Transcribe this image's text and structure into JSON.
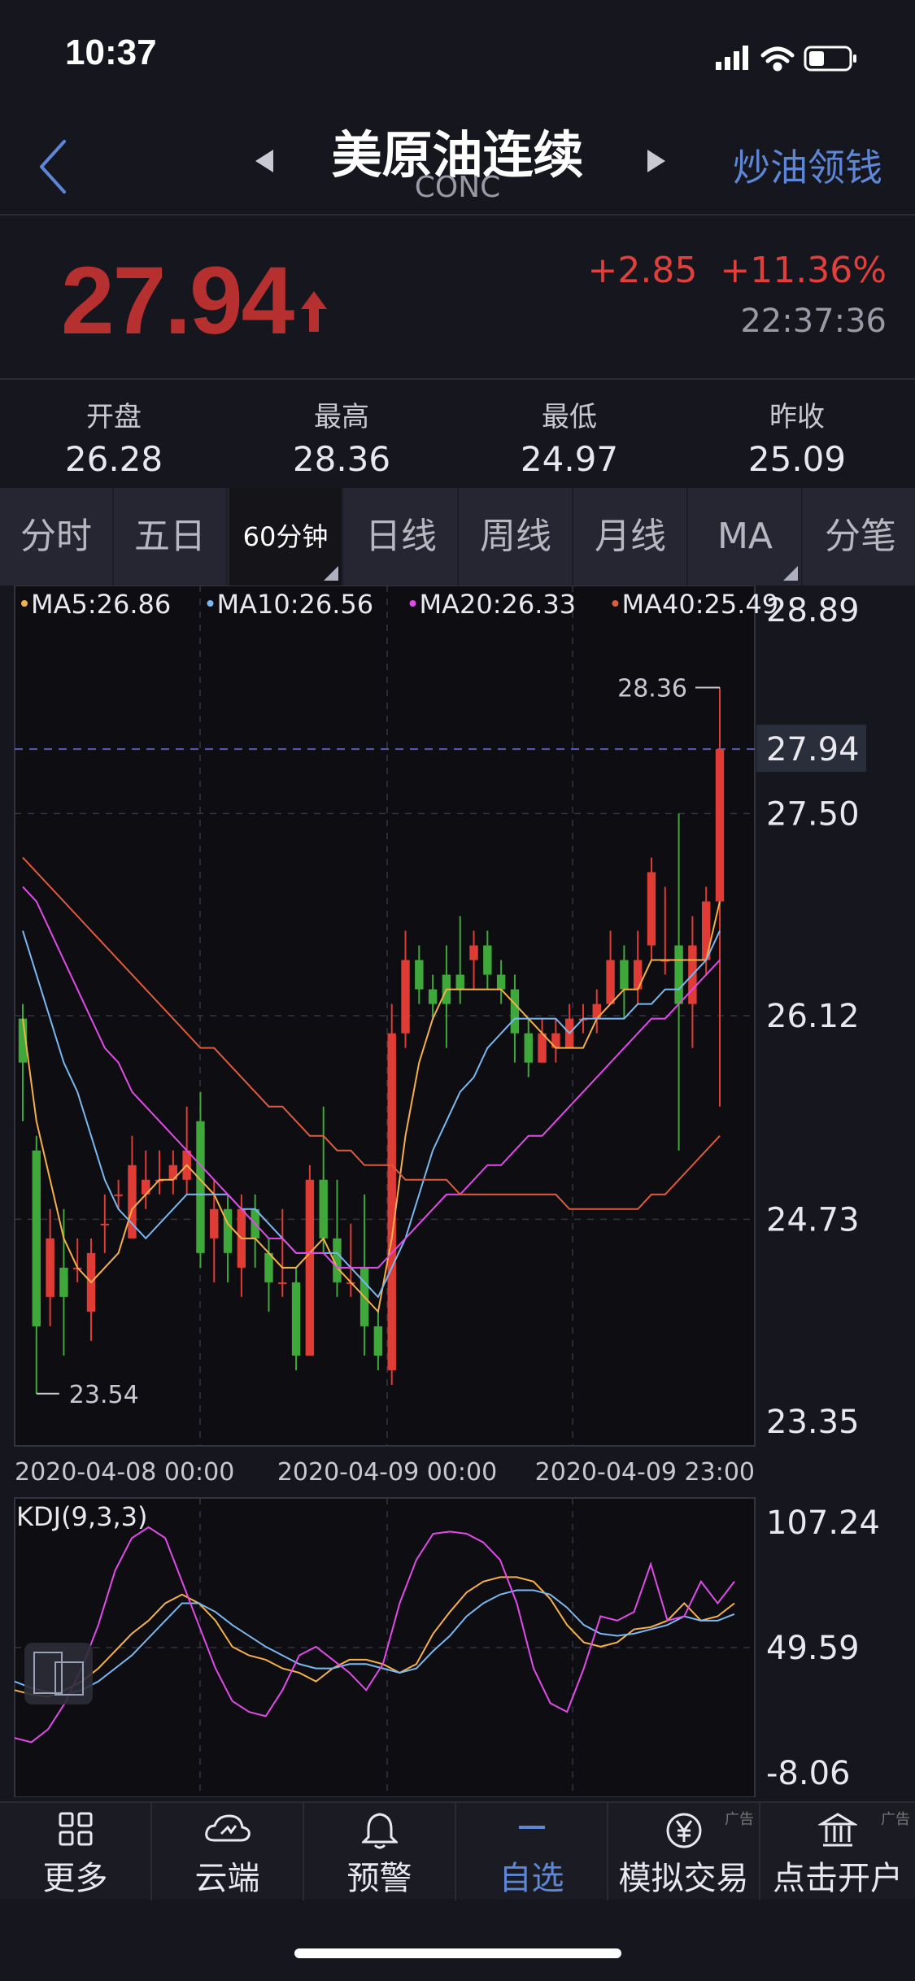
{
  "status_bar": {
    "time": "10:37"
  },
  "nav": {
    "title": "美原油连续",
    "subtitle": "CONC",
    "promo_label": "炒油领钱"
  },
  "quote": {
    "price": "27.94",
    "change": "+2.85",
    "change_pct": "+11.36%",
    "quote_time": "22:37:36"
  },
  "stats": [
    {
      "label": "开盘",
      "value": "26.28"
    },
    {
      "label": "最高",
      "value": "28.36"
    },
    {
      "label": "最低",
      "value": "24.97"
    },
    {
      "label": "昨收",
      "value": "25.09"
    }
  ],
  "period_tabs": [
    {
      "label": "分时"
    },
    {
      "label": "五日"
    },
    {
      "label": "60分钟",
      "active": true
    },
    {
      "label": "日线"
    },
    {
      "label": "周线"
    },
    {
      "label": "月线"
    },
    {
      "label": "MA"
    },
    {
      "label": "分笔"
    }
  ],
  "ma_legend": [
    {
      "label": "MA5:26.86",
      "color": "#f5b04a"
    },
    {
      "label": "MA10:26.56",
      "color": "#7ab8f0"
    },
    {
      "label": "MA20:26.33",
      "color": "#e04be8"
    },
    {
      "label": "MA40:25.49",
      "color": "#e05a3c"
    }
  ],
  "chart_data": [
    {
      "type": "candlestick",
      "title": "",
      "y_ticks": [
        "28.89",
        "27.50",
        "26.12",
        "24.73",
        "23.35"
      ],
      "ylim": [
        23.35,
        28.89
      ],
      "last_price_label": "27.94",
      "high_annotation": "28.36",
      "low_annotation": "23.54",
      "x_ticks": [
        "2020-04-08 00:00",
        "2020-04-09 00:00",
        "2020-04-09 23:00"
      ],
      "candles": [
        [
          26.1,
          25.8,
          26.2,
          25.4
        ],
        [
          25.2,
          24.0,
          25.3,
          23.54
        ],
        [
          24.2,
          24.6,
          24.8,
          24.0
        ],
        [
          24.4,
          24.2,
          24.8,
          23.8
        ],
        [
          24.4,
          24.4,
          24.6,
          24.3
        ],
        [
          24.1,
          24.5,
          24.6,
          23.9
        ],
        [
          24.7,
          24.7,
          24.9,
          24.5
        ],
        [
          24.9,
          24.9,
          25.0,
          24.8
        ],
        [
          24.6,
          25.1,
          25.3,
          24.6
        ],
        [
          24.9,
          25.0,
          25.2,
          24.8
        ],
        [
          25.0,
          25.0,
          25.2,
          24.9
        ],
        [
          25.0,
          25.1,
          25.2,
          24.9
        ],
        [
          25.0,
          25.2,
          25.5,
          24.9
        ],
        [
          25.4,
          24.5,
          25.6,
          24.4
        ],
        [
          24.6,
          24.8,
          25.0,
          24.3
        ],
        [
          24.8,
          24.5,
          24.9,
          24.3
        ],
        [
          24.4,
          24.8,
          24.9,
          24.2
        ],
        [
          24.8,
          24.6,
          24.9,
          24.4
        ],
        [
          24.5,
          24.3,
          24.6,
          24.1
        ],
        [
          24.3,
          24.3,
          24.8,
          24.2
        ],
        [
          24.3,
          23.8,
          24.4,
          23.7
        ],
        [
          23.8,
          25.0,
          25.1,
          23.8
        ],
        [
          25.0,
          24.6,
          25.5,
          24.5
        ],
        [
          24.6,
          24.3,
          25.0,
          24.2
        ],
        [
          24.3,
          24.3,
          24.7,
          24.2
        ],
        [
          24.4,
          24.0,
          24.9,
          23.8
        ],
        [
          24.0,
          23.8,
          24.1,
          23.7
        ],
        [
          23.7,
          26.0,
          26.2,
          23.6
        ],
        [
          26.0,
          26.5,
          26.7,
          25.9
        ],
        [
          26.5,
          26.3,
          26.6,
          26.2
        ],
        [
          26.3,
          26.2,
          26.4,
          26.1
        ],
        [
          26.4,
          26.2,
          26.6,
          25.9
        ],
        [
          26.4,
          26.3,
          26.8,
          26.2
        ],
        [
          26.5,
          26.6,
          26.7,
          26.3
        ],
        [
          26.6,
          26.4,
          26.7,
          26.3
        ],
        [
          26.4,
          26.3,
          26.5,
          26.2
        ],
        [
          26.3,
          26.0,
          26.4,
          25.8
        ],
        [
          26.0,
          25.8,
          26.1,
          25.7
        ],
        [
          25.8,
          26.0,
          26.1,
          25.8
        ],
        [
          25.9,
          26.0,
          26.1,
          25.8
        ],
        [
          25.9,
          26.1,
          26.2,
          25.9
        ],
        [
          26.1,
          26.1,
          26.2,
          26.0
        ],
        [
          26.1,
          26.2,
          26.3,
          26.0
        ],
        [
          26.2,
          26.5,
          26.7,
          26.2
        ],
        [
          26.5,
          26.3,
          26.6,
          26.1
        ],
        [
          26.3,
          26.5,
          26.7,
          26.2
        ],
        [
          26.6,
          27.1,
          27.2,
          26.5
        ],
        [
          26.5,
          26.5,
          27.0,
          26.4
        ],
        [
          26.6,
          26.2,
          27.5,
          25.2
        ],
        [
          26.2,
          26.6,
          26.8,
          25.9
        ],
        [
          26.5,
          26.9,
          27.0,
          26.4
        ],
        [
          26.9,
          27.94,
          28.36,
          25.5
        ]
      ],
      "ma5": [
        26.1,
        25.4,
        25.0,
        24.6,
        24.4,
        24.3,
        24.4,
        24.5,
        24.8,
        24.9,
        25.0,
        25.0,
        25.1,
        25.0,
        24.9,
        24.7,
        24.6,
        24.6,
        24.5,
        24.4,
        24.4,
        24.5,
        24.6,
        24.4,
        24.3,
        24.2,
        24.1,
        24.6,
        25.3,
        25.8,
        26.1,
        26.3,
        26.3,
        26.3,
        26.3,
        26.3,
        26.2,
        26.1,
        26.0,
        25.9,
        25.9,
        25.9,
        26.1,
        26.2,
        26.3,
        26.3,
        26.5,
        26.5,
        26.5,
        26.5,
        26.5,
        26.9
      ],
      "ma10": [
        26.7,
        26.4,
        26.1,
        25.8,
        25.6,
        25.3,
        25.0,
        24.8,
        24.7,
        24.6,
        24.7,
        24.8,
        24.9,
        24.9,
        24.9,
        24.9,
        24.8,
        24.8,
        24.7,
        24.6,
        24.5,
        24.5,
        24.5,
        24.5,
        24.4,
        24.3,
        24.2,
        24.4,
        24.6,
        24.9,
        25.2,
        25.4,
        25.6,
        25.7,
        25.9,
        26.0,
        26.1,
        26.1,
        26.1,
        26.1,
        26.0,
        26.1,
        26.1,
        26.1,
        26.1,
        26.2,
        26.2,
        26.3,
        26.3,
        26.4,
        26.5,
        26.7
      ],
      "ma20": [
        27.0,
        26.9,
        26.7,
        26.5,
        26.3,
        26.1,
        25.9,
        25.8,
        25.6,
        25.5,
        25.4,
        25.3,
        25.2,
        25.1,
        25.0,
        24.9,
        24.8,
        24.7,
        24.6,
        24.6,
        24.5,
        24.5,
        24.5,
        24.4,
        24.4,
        24.4,
        24.4,
        24.5,
        24.6,
        24.7,
        24.8,
        24.9,
        24.9,
        25.0,
        25.1,
        25.1,
        25.2,
        25.3,
        25.3,
        25.4,
        25.5,
        25.6,
        25.7,
        25.8,
        25.9,
        26.0,
        26.1,
        26.1,
        26.2,
        26.3,
        26.4,
        26.5
      ],
      "ma40": [
        27.2,
        27.1,
        27.0,
        26.9,
        26.8,
        26.7,
        26.6,
        26.5,
        26.4,
        26.3,
        26.2,
        26.1,
        26.0,
        25.9,
        25.9,
        25.8,
        25.7,
        25.6,
        25.5,
        25.5,
        25.4,
        25.3,
        25.3,
        25.2,
        25.2,
        25.1,
        25.1,
        25.1,
        25.0,
        25.0,
        25.0,
        25.0,
        24.9,
        24.9,
        24.9,
        24.9,
        24.9,
        24.9,
        24.9,
        24.9,
        24.8,
        24.8,
        24.8,
        24.8,
        24.8,
        24.8,
        24.9,
        24.9,
        25.0,
        25.1,
        25.2,
        25.3
      ]
    },
    {
      "type": "line",
      "title": "KDJ(9,3,3)",
      "y_ticks": [
        "107.24",
        "49.59",
        "-8.06"
      ],
      "ylim": [
        -8.06,
        107.24
      ],
      "series": [
        {
          "name": "K",
          "color": "#f5b04a",
          "values": [
            30,
            28,
            27,
            30,
            34,
            40,
            48,
            56,
            62,
            70,
            74,
            70,
            62,
            50,
            46,
            44,
            40,
            38,
            34,
            40,
            44,
            44,
            42,
            38,
            42,
            56,
            66,
            75,
            80,
            82,
            82,
            80,
            72,
            60,
            52,
            50,
            52,
            58,
            59,
            62,
            70,
            62,
            64,
            70
          ]
        },
        {
          "name": "D",
          "color": "#7ab8f0",
          "values": [
            34,
            31,
            29,
            28,
            30,
            34,
            40,
            46,
            54,
            62,
            70,
            70,
            66,
            60,
            55,
            50,
            46,
            42,
            40,
            40,
            42,
            42,
            40,
            38,
            40,
            48,
            55,
            64,
            70,
            74,
            76,
            76,
            74,
            68,
            60,
            56,
            55,
            56,
            58,
            60,
            64,
            62,
            62,
            65
          ]
        },
        {
          "name": "J",
          "color": "#e04be8",
          "values": [
            8,
            6,
            12,
            24,
            40,
            60,
            85,
            100,
            105,
            100,
            80,
            60,
            40,
            25,
            20,
            18,
            30,
            46,
            50,
            44,
            38,
            30,
            42,
            70,
            90,
            102,
            103,
            102,
            98,
            90,
            70,
            40,
            24,
            20,
            40,
            64,
            62,
            66,
            88,
            62,
            64,
            80,
            70,
            80
          ]
        }
      ]
    }
  ],
  "bottom_tabs": [
    {
      "label": "更多",
      "icon": "grid-icon",
      "ad": ""
    },
    {
      "label": "云端",
      "icon": "cloud-sync-icon",
      "ad": ""
    },
    {
      "label": "预警",
      "icon": "bell-icon",
      "ad": ""
    },
    {
      "label": "自选",
      "icon": "dash-icon",
      "active": true,
      "ad": ""
    },
    {
      "label": "模拟交易",
      "icon": "yen-coin-icon",
      "ad": "广告"
    },
    {
      "label": "点击开户",
      "icon": "bank-icon",
      "ad": "广告"
    }
  ]
}
